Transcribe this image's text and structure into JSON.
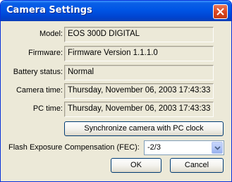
{
  "window": {
    "title": "Camera Settings"
  },
  "fields": [
    {
      "label": "Model:",
      "value": "EOS 300D DIGITAL"
    },
    {
      "label": "Firmware:",
      "value": "Firmware Version 1.1.1.0"
    },
    {
      "label": "Battery status:",
      "value": "Normal"
    },
    {
      "label": "Camera time:",
      "value": "Thursday, November 06, 2003 17:43:33"
    },
    {
      "label": "PC time:",
      "value": "Thursday, November 06, 2003 17:43:33"
    }
  ],
  "sync_button": "Synchronize camera with PC clock",
  "fec": {
    "label": "Flash Exposure Compensation (FEC):",
    "selected": "-2/3"
  },
  "buttons": {
    "ok": "OK",
    "cancel": "Cancel"
  },
  "icons": {
    "close": "close-icon",
    "dropdown": "chevron-down-icon"
  },
  "colors": {
    "titlebar": "#0055e5",
    "dialog_bg": "#ece9d8",
    "close_button": "#d9441f"
  }
}
